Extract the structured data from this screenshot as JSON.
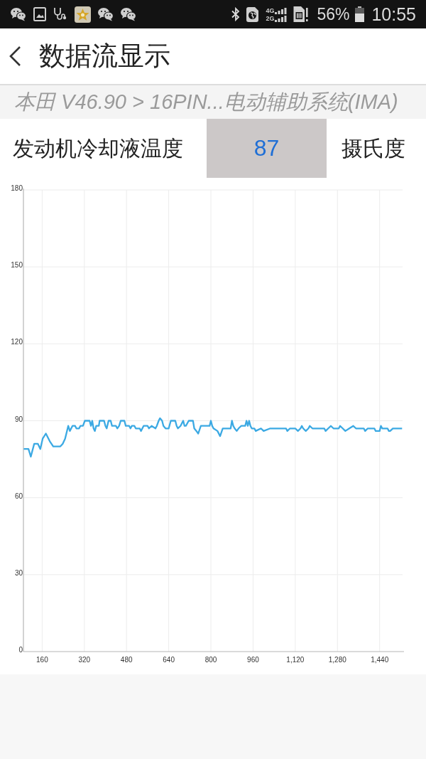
{
  "status_bar": {
    "network_types": [
      "4G",
      "2G"
    ],
    "battery": "56%",
    "time": "10:55"
  },
  "header": {
    "title": "数据流显示"
  },
  "breadcrumb": "本田 V46.90 > 16PIN...电动辅助系统(IMA)",
  "reading": {
    "name": "发动机冷却液温度",
    "value": "87",
    "unit": "摄氏度"
  },
  "chart": {
    "chart_data": {
      "type": "line",
      "x": [
        90,
        108,
        117,
        130,
        144,
        153,
        162,
        174,
        189,
        202,
        229,
        238,
        247,
        259,
        265,
        275,
        285,
        290,
        300,
        305,
        315,
        322,
        340,
        345,
        350,
        355,
        360,
        365,
        375,
        378,
        395,
        400,
        405,
        412,
        420,
        425,
        440,
        445,
        452,
        458,
        472,
        477,
        490,
        495,
        500,
        510,
        515,
        530,
        535,
        540,
        545,
        560,
        565,
        575,
        590,
        595,
        602,
        607,
        615,
        620,
        628,
        640,
        648,
        665,
        670,
        675,
        685,
        695,
        700,
        705,
        716,
        732,
        737,
        745,
        752,
        762,
        795,
        800,
        805,
        810,
        825,
        835,
        845,
        875,
        880,
        885,
        890,
        898,
        905,
        915,
        930,
        935,
        940,
        945,
        950,
        955,
        965,
        970,
        990,
        1000,
        1025,
        1085,
        1090,
        1100,
        1120,
        1130,
        1140,
        1145,
        1150,
        1160,
        1170,
        1175,
        1185,
        1230,
        1235,
        1245,
        1255,
        1265,
        1285,
        1290,
        1300,
        1310,
        1325,
        1340,
        1350,
        1380,
        1385,
        1395,
        1420,
        1425,
        1440,
        1445,
        1450,
        1470,
        1475,
        1480,
        1490,
        1525
      ],
      "series": [
        {
          "color": "#3ba9e3",
          "values": [
            79,
            79,
            76,
            81,
            81,
            79,
            83,
            85,
            82,
            80,
            80,
            81,
            83,
            88,
            86,
            88,
            88,
            87,
            87,
            88,
            88,
            90,
            90,
            88,
            90,
            87,
            86,
            88,
            88,
            90,
            90,
            88,
            87,
            90,
            90,
            88,
            88,
            87,
            88,
            90,
            90,
            88,
            88,
            87,
            88,
            88,
            87,
            87,
            86,
            87,
            88,
            88,
            87,
            88,
            87,
            88,
            90,
            91,
            90,
            88,
            87,
            87,
            90,
            90,
            88,
            87,
            88,
            90,
            88,
            88,
            90,
            90,
            87,
            86,
            85,
            88,
            88,
            90,
            88,
            87,
            86,
            84,
            87,
            87,
            90,
            88,
            87,
            86,
            87,
            88,
            88,
            90,
            88,
            90,
            88,
            87,
            87,
            86,
            87,
            86,
            87,
            87,
            86,
            87,
            87,
            86,
            87,
            88,
            87,
            86,
            87,
            88,
            87,
            87,
            86,
            87,
            88,
            87,
            87,
            88,
            87,
            86,
            87,
            88,
            87,
            87,
            86,
            87,
            87,
            86,
            86,
            88,
            87,
            87,
            86,
            86,
            87,
            87
          ]
        }
      ],
      "xlim": [
        89,
        1527
      ],
      "ylim": [
        0,
        180
      ],
      "xticks": [
        160,
        320,
        480,
        640,
        800,
        960,
        {
          "value": 1120,
          "label": "1,120"
        },
        {
          "value": 1280,
          "label": "1,280"
        },
        {
          "value": 1440,
          "label": "1,440"
        }
      ],
      "yticks": [
        0,
        30,
        60,
        90,
        120,
        150,
        180
      ],
      "grid": true
    }
  }
}
